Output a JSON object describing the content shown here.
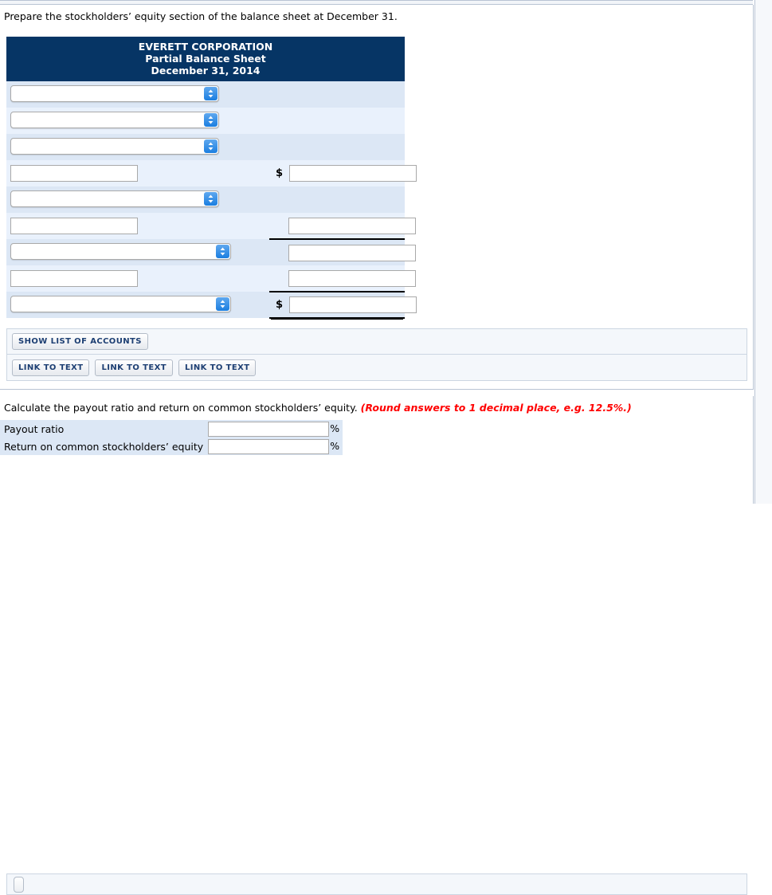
{
  "question": {
    "prompt": "Prepare the stockholders’ equity section of the balance sheet at December 31."
  },
  "balance_sheet": {
    "company": "EVERETT CORPORATION",
    "statement": "Partial Balance Sheet",
    "date": "December 31, 2014",
    "rows": [
      {
        "type": "select",
        "value": "",
        "amount": ""
      },
      {
        "type": "select",
        "value": "",
        "amount": ""
      },
      {
        "type": "select",
        "value": "",
        "amount": ""
      },
      {
        "type": "text",
        "value": "",
        "amount": "",
        "currency": "$"
      },
      {
        "type": "select",
        "value": "",
        "amount": ""
      },
      {
        "type": "text",
        "value": "",
        "amount": ""
      },
      {
        "type": "select",
        "value": "",
        "amount": ""
      },
      {
        "type": "text",
        "value": "",
        "amount": ""
      },
      {
        "type": "select",
        "value": "",
        "amount": "",
        "currency": "$"
      }
    ]
  },
  "toolbar": {
    "show_accounts_label": "SHOW LIST OF ACCOUNTS",
    "link_to_text_label": "LINK TO TEXT",
    "link_buttons": [
      {
        "label": "LINK TO TEXT"
      },
      {
        "label": "LINK TO TEXT"
      },
      {
        "label": "LINK TO TEXT"
      }
    ]
  },
  "calculation": {
    "prompt": "Calculate the payout ratio and return on common stockholders’ equity.",
    "round_note": "(Round answers to 1 decimal place, e.g. 12.5%.)",
    "rows": [
      {
        "label": "Payout ratio",
        "value": "",
        "unit": "%"
      },
      {
        "label": "Return on common stockholders’ equity",
        "value": "",
        "unit": "%"
      }
    ]
  },
  "colors": {
    "header_navy": "#063565",
    "row_dark": "#dce7f5",
    "row_light": "#e9f1fc",
    "button_text": "#1d3f73",
    "note_red": "#ff0000",
    "spinner_blue": "#1b7ee0"
  }
}
